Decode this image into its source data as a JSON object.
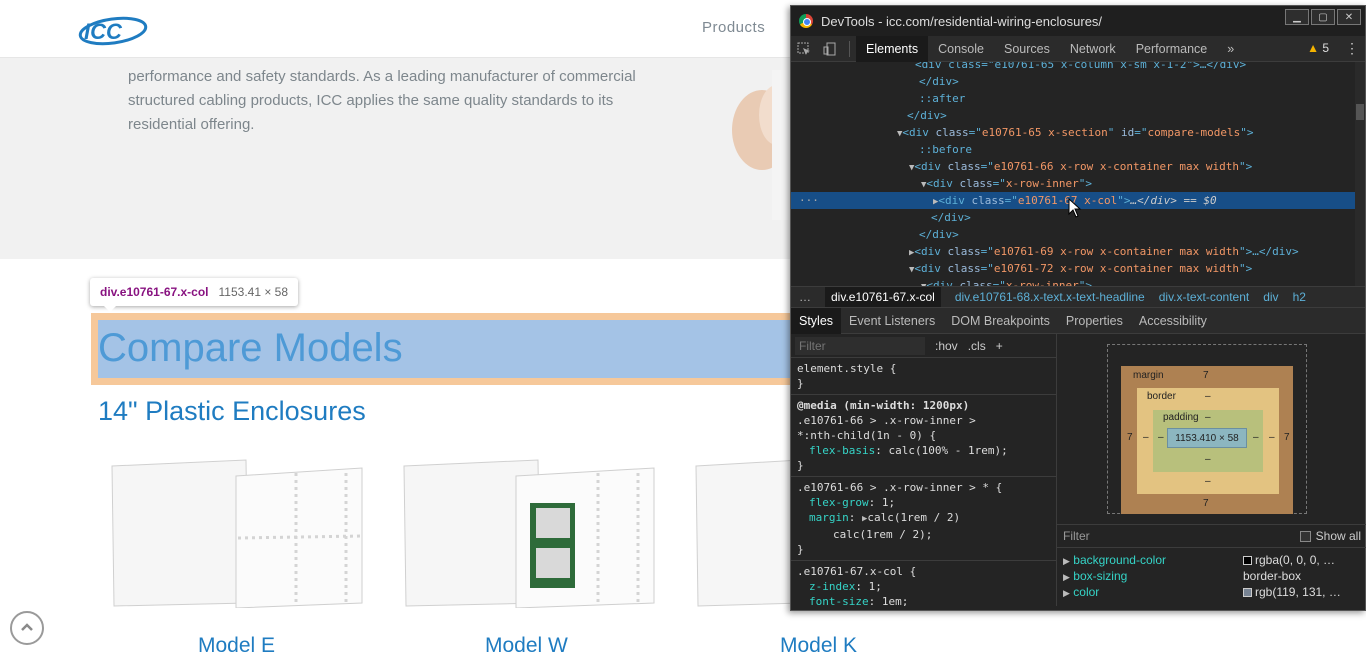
{
  "site": {
    "logo_text": "ICC",
    "nav": {
      "products": "Products"
    },
    "hero_text": "performance and safety standards. As a leading manufacturer of commercial structured cabling products, ICC applies the same quality standards to its residential offering.",
    "section_title": "Compare Models",
    "subtitle": "14\" Plastic Enclosures",
    "models": [
      "Model E",
      "Model W",
      "Model K"
    ]
  },
  "inspector_tooltip": {
    "selector": "div.e10761-67.x-col",
    "size": "1153.41 × 58"
  },
  "devtools": {
    "title": "DevTools - icc.com/residential-wiring-enclosures/",
    "tabs": [
      "Elements",
      "Console",
      "Sources",
      "Network",
      "Performance"
    ],
    "more_tabs": "»",
    "warnings": "5",
    "dom_lines": [
      {
        "text_tag": "<div class=\"e10761-65 x-column x-sm x-1-2\">…</div>"
      },
      {
        "text_tag": "</div>"
      },
      {
        "text_tag": "::after"
      },
      {
        "text_tag": "</div>"
      },
      {
        "tag": "div",
        "class": "e10761-65 x-section",
        "id": "compare-models"
      },
      {
        "text_tag": "::before"
      },
      {
        "tag": "div",
        "class": "e10761-66 x-row x-container max width"
      },
      {
        "tag": "div",
        "class": "x-row-inner"
      },
      {
        "tag": "div",
        "class": "e10761-67 x-col",
        "suffix": "…</div> == $0"
      },
      {
        "text_tag": "</div>"
      },
      {
        "text_tag": "</div>"
      },
      {
        "tag": "div",
        "class": "e10761-69 x-row x-container max width",
        "suffix": "…</div>"
      },
      {
        "tag": "div",
        "class": "e10761-72 x-row x-container max width"
      },
      {
        "tag": "div",
        "class": "x-row-inner"
      }
    ],
    "breadcrumbs": [
      "…",
      "div.e10761-67.x-col",
      "div.e10761-68.x-text.x-text-headline",
      "div.x-text-content",
      "div",
      "h2"
    ],
    "sub_tabs": [
      "Styles",
      "Event Listeners",
      "DOM Breakpoints",
      "Properties",
      "Accessibility"
    ],
    "styles": {
      "filter_placeholder": "Filter",
      "hov": ":hov",
      "cls": ".cls",
      "plus": "+",
      "element_style": "element.style {",
      "media": "@media (min-width: 1200px)",
      "rule1_selector_a": ".e10761-66 > .x-row-inner >",
      "rule1_selector_b": "*:nth-child(1n - 0) {",
      "rule1_prop": "flex-basis",
      "rule1_val": "calc(100% - 1rem);",
      "rule2_selector": ".e10761-66 > .x-row-inner > * {",
      "rule2_prop1": "flex-grow",
      "rule2_val1": "1;",
      "rule2_prop2": "margin",
      "rule2_val2": "calc(1rem / 2)",
      "rule2_val2b": "calc(1rem / 2);",
      "rule3_selector": ".e10761-67.x-col {",
      "rule3_prop1": "z-index",
      "rule3_val1": "1;",
      "rule3_prop2": "font-size",
      "rule3_val2": "1em;",
      "close_brace": "}"
    },
    "box_model": {
      "margin_label": "margin",
      "margin_value": "7",
      "border_label": "border",
      "border_value": "–",
      "padding_label": "padding",
      "padding_value": "–",
      "content": "1153.410 × 58",
      "side_dash": "–"
    },
    "computed": {
      "filter_placeholder": "Filter",
      "show_all": "Show all",
      "rows": [
        {
          "name": "background-color",
          "value": "rgba(0, 0, 0, …",
          "swatch": "#000000"
        },
        {
          "name": "box-sizing",
          "value": "border-box"
        },
        {
          "name": "color",
          "value": "rgb(119, 131, …",
          "swatch": "#778393"
        }
      ]
    }
  },
  "colors": {
    "accent_blue": "#1f7cc1",
    "title_blue": "#4e9ad6",
    "highlight_content": "#a4c3e6",
    "highlight_margin": "#f6c89a"
  }
}
